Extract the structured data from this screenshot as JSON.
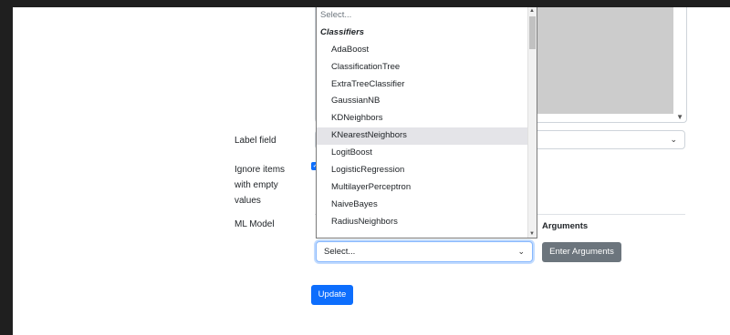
{
  "labels": {
    "label_field": "Label field",
    "ignore_items": [
      "Ignore items",
      "with empty",
      "values"
    ],
    "ml_model": "ML Model",
    "arguments": "Arguments"
  },
  "ml_model_select": {
    "value": "Select..."
  },
  "buttons": {
    "enter_arguments": "Enter Arguments",
    "update": "Update"
  },
  "dropdown": {
    "placeholder": "Select...",
    "group": "Classifiers",
    "options": [
      "AdaBoost",
      "ClassificationTree",
      "ExtraTreeClassifier",
      "GaussianNB",
      "KDNeighbors",
      "KNearestNeighbors",
      "LogitBoost",
      "LogisticRegression",
      "MultilayerPerceptron",
      "NaiveBayes",
      "RadiusNeighbors"
    ],
    "highlighted": "KNearestNeighbors"
  },
  "colors": {
    "primary": "#0d6efd",
    "secondary": "#6c757d",
    "highlight_row": "#e4e4e8"
  }
}
